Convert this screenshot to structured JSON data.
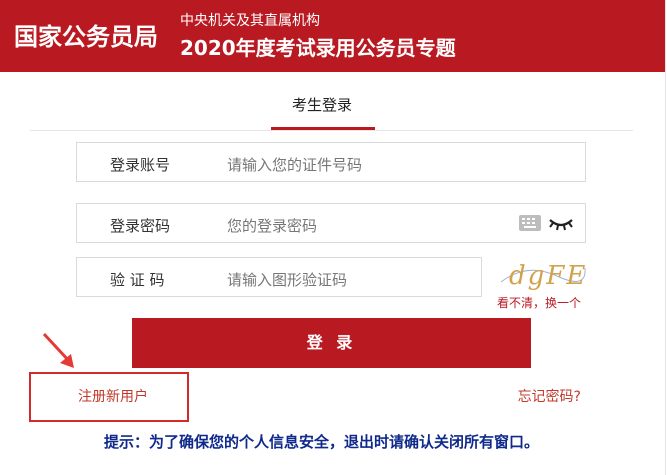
{
  "header": {
    "brand": "国家公务员局",
    "subtitle_line1": "中央机关及其直属机构",
    "subtitle_line2": "2020年度考试录用公务员专题"
  },
  "tabs": {
    "active": "考生登录"
  },
  "form": {
    "account": {
      "label": "登录账号",
      "placeholder": "请输入您的证件号码"
    },
    "password": {
      "label": "登录密码",
      "placeholder": "您的登录密码"
    },
    "captcha": {
      "label": "验 证 码",
      "placeholder": "请输入图形验证码",
      "image_text": "dgFE",
      "refresh_label": "看不清，换一个"
    },
    "login_button": "登 录"
  },
  "links": {
    "register": "注册新用户",
    "forgot_password": "忘记密码?"
  },
  "tip": "提示：为了确保您的个人信息安全，退出时请确认关闭所有窗口。",
  "colors": {
    "brand_red": "#b91a22",
    "tip_blue": "#102a8c",
    "annotation_red": "#e53935"
  }
}
